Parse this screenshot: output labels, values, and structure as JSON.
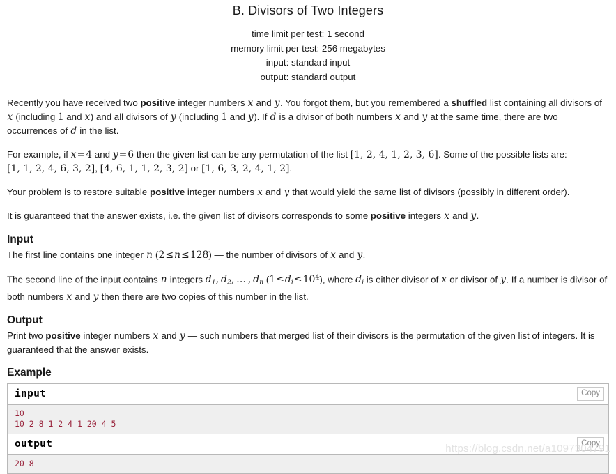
{
  "problem": {
    "title": "B. Divisors of Two Integers",
    "limits": {
      "time": "time limit per test: 1 second",
      "memory": "memory limit per test: 256 megabytes",
      "input": "input: standard input",
      "output": "output: standard output"
    }
  },
  "statement": {
    "p1": {
      "t1": "Recently you have received two ",
      "b1": "positive",
      "t2": " integer numbers ",
      "m1": "x",
      "t3": " and ",
      "m2": "y",
      "t4": ". You forgot them, but you remembered a ",
      "b2": "shuffled",
      "t5": " list containing all divisors of ",
      "m3": "x",
      "t6": " (including ",
      "m4": "1",
      "t7": " and ",
      "m5": "x",
      "t8": ") and all divisors of ",
      "m6": "y",
      "t9": " (including ",
      "m7": "1",
      "t10": " and ",
      "m8": "y",
      "t11": "). If ",
      "m9": "d",
      "t12": " is a divisor of both numbers ",
      "m10": "x",
      "t13": " and ",
      "m11": "y",
      "t14": " at the same time, there are two occurrences of ",
      "m12": "d",
      "t15": " in the list."
    },
    "p2": {
      "t1": "For example, if ",
      "eq1": "x = 4",
      "t2": " and ",
      "eq2": "y = 6",
      "t3": " then the given list can be any permutation of the list ",
      "list1": "[1, 2, 4, 1, 2, 3, 6]",
      "t4": ". Some of the possible lists are: ",
      "list2": "[1, 1, 2, 4, 6, 3, 2]",
      "t5": ", ",
      "list3": "[4, 6, 1, 1, 2, 3, 2]",
      "t6": " or ",
      "list4": "[1, 6, 3, 2, 4, 1, 2]",
      "t7": "."
    },
    "p3": {
      "t1": "Your problem is to restore suitable ",
      "b1": "positive",
      "t2": " integer numbers ",
      "m1": "x",
      "t3": " and ",
      "m2": "y",
      "t4": " that would yield the same list of divisors (possibly in different order)."
    },
    "p4": {
      "t1": "It is guaranteed that the answer exists, i.e. the given list of divisors corresponds to some ",
      "b1": "positive",
      "t2": " integers ",
      "m1": "x",
      "t3": " and ",
      "m2": "y",
      "t4": "."
    }
  },
  "input_section": {
    "heading": "Input",
    "p1": {
      "t1": "The first line contains one integer ",
      "m1": "n",
      "t2": " (",
      "eq1": "2 ≤ n ≤ 128",
      "t3": ") — the number of divisors of ",
      "m2": "x",
      "t4": " and ",
      "m3": "y",
      "t5": "."
    },
    "p2": {
      "t1": "The second line of the input contains ",
      "m1": "n",
      "t2": " integers ",
      "d_list": "d1, d2, … , dn",
      "t3": " (",
      "eq1": "1 ≤ di ≤ 10^4",
      "t4": "), where ",
      "m2": "di",
      "t5": " is either divisor of ",
      "m3": "x",
      "t6": " or divisor of ",
      "m4": "y",
      "t7": ". If a number is divisor of both numbers ",
      "m5": "x",
      "t8": " and ",
      "m6": "y",
      "t9": " then there are two copies of this number in the list."
    }
  },
  "output_section": {
    "heading": "Output",
    "p1": {
      "t1": "Print two ",
      "b1": "positive",
      "t2": " integer numbers ",
      "m1": "x",
      "t3": " and ",
      "m2": "y",
      "t4": " — such numbers that merged list of their divisors is the permutation of the given list of integers. It is guaranteed that the answer exists."
    }
  },
  "example": {
    "heading": "Example",
    "input_label": "input",
    "input_data": "10\n10 2 8 1 2 4 1 20 4 5",
    "output_label": "output",
    "output_data": "20 8",
    "copy_label": "Copy"
  },
  "watermark": "https://blog.csdn.net/a1097304791",
  "colors": {
    "text": "#1a1a1a",
    "sample_data": "#99233b",
    "sample_bg": "#efefef",
    "border": "#b8b8b8",
    "watermark": "#e2e2e2"
  }
}
